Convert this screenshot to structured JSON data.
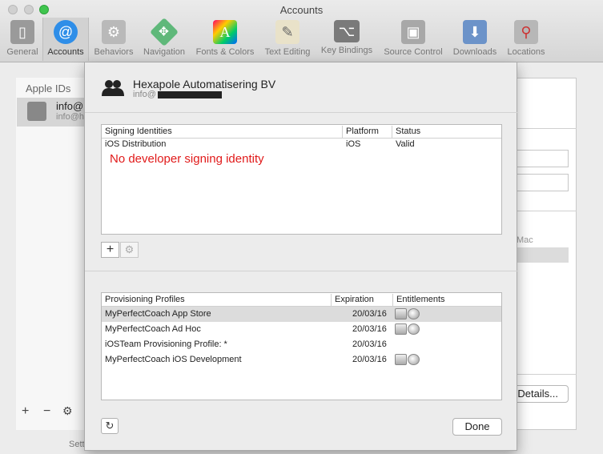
{
  "window": {
    "title": "Accounts"
  },
  "toolbar": {
    "items": [
      {
        "label": "General",
        "icon": "switch-icon",
        "selected": false
      },
      {
        "label": "Accounts",
        "icon": "at-icon",
        "selected": true
      },
      {
        "label": "Behaviors",
        "icon": "gear-icon",
        "selected": false
      },
      {
        "label": "Navigation",
        "icon": "navigation-icon",
        "selected": false
      },
      {
        "label": "Fonts & Colors",
        "icon": "font-icon",
        "selected": false
      },
      {
        "label": "Text Editing",
        "icon": "pencil-icon",
        "selected": false
      },
      {
        "label": "Key Bindings",
        "icon": "keyboard-icon",
        "selected": false
      },
      {
        "label": "Source Control",
        "icon": "vault-icon",
        "selected": false
      },
      {
        "label": "Downloads",
        "icon": "download-icon",
        "selected": false
      },
      {
        "label": "Locations",
        "icon": "joystick-icon",
        "selected": false
      }
    ],
    "glyphs": {
      "general": "▯",
      "accounts": "@",
      "behaviors": "⚙",
      "navigation": "✥",
      "fonts": "A",
      "textediting": "✎",
      "keybindings": "⌥",
      "sourcecontrol": "▣",
      "downloads": "⬇",
      "locations": "⚲"
    }
  },
  "background": {
    "apple_ids_header": "Apple IDs",
    "account_name": "info@l",
    "account_email": "info@h",
    "mac_label": "Mac",
    "details_button": "Details...",
    "settings_label": "Setti",
    "add_glyph": "+",
    "remove_glyph": "−",
    "gear_glyph": "⚙"
  },
  "sheet": {
    "team_name": "Hexapole Automatisering BV",
    "team_email_prefix": "info@",
    "signing": {
      "columns": [
        "Signing Identities",
        "Platform",
        "Status"
      ],
      "rows": [
        {
          "identity": "iOS Distribution",
          "platform": "iOS",
          "status": "Valid"
        }
      ],
      "annotation": "No developer signing identity"
    },
    "add_glyph": "+",
    "gear_glyph": "⚙",
    "profiles": {
      "columns": [
        "Provisioning Profiles",
        "Expiration",
        "Entitlements"
      ],
      "rows": [
        {
          "name": "MyPerfectCoach App Store",
          "expiration": "20/03/16",
          "entitlements": true,
          "selected": true
        },
        {
          "name": "MyPerfectCoach Ad Hoc",
          "expiration": "20/03/16",
          "entitlements": true,
          "selected": false
        },
        {
          "name": "iOSTeam Provisioning Profile: *",
          "expiration": "20/03/16",
          "entitlements": false,
          "selected": false
        },
        {
          "name": "MyPerfectCoach iOS Development",
          "expiration": "20/03/16",
          "entitlements": true,
          "selected": false
        }
      ]
    },
    "refresh_glyph": "↻",
    "done_button": "Done"
  },
  "colors": {
    "annotation": "#e11a1a",
    "selected_row": "#dcdcdc",
    "accent": "#2f8ee8",
    "traffic_green": "#3fc54e"
  }
}
